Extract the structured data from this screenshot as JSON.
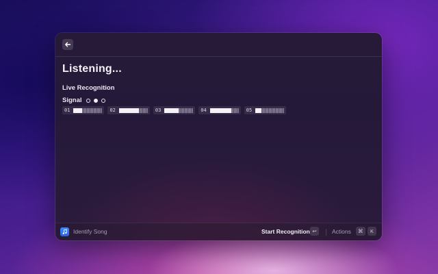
{
  "header": {
    "back_icon": "arrow-left-icon"
  },
  "main": {
    "title": "Listening...",
    "section_heading": "Live Recognition",
    "signal": {
      "label": "Signal",
      "dots": [
        "empty",
        "filled",
        "empty"
      ]
    },
    "meters": [
      {
        "label": "01",
        "level": 0.3
      },
      {
        "label": "02",
        "level": 0.7
      },
      {
        "label": "03",
        "level": 0.5
      },
      {
        "label": "04",
        "level": 0.75
      },
      {
        "label": "05",
        "level": 0.2
      }
    ]
  },
  "footer": {
    "app_icon": "music-note-icon",
    "app_name": "Identify Song",
    "primary_action": "Start Recognition",
    "primary_shortcut": "↩",
    "actions_label": "Actions",
    "actions_shortcut_1": "⌘",
    "actions_shortcut_2": "K"
  },
  "colors": {
    "accent_blue": "#3d8bff",
    "text_primary": "#f4f1f7",
    "text_secondary": "#a59db3"
  }
}
